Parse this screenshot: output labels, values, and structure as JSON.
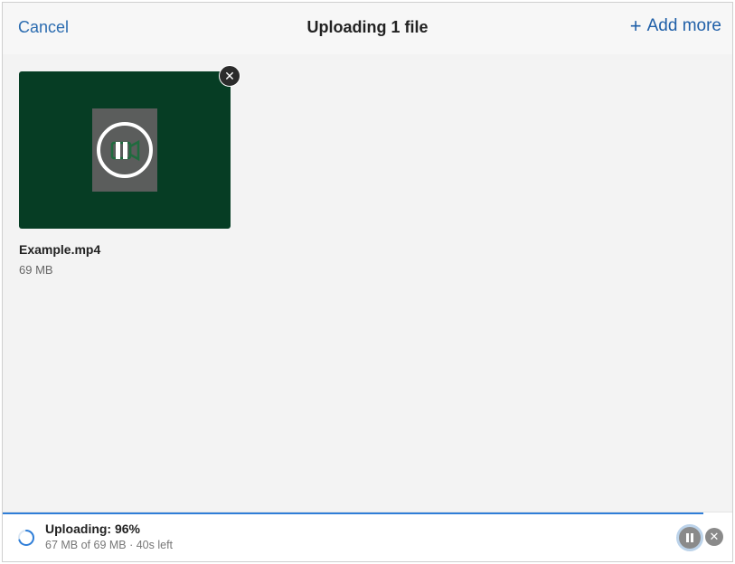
{
  "header": {
    "cancel_label": "Cancel",
    "title": "Uploading 1 file",
    "add_more_label": "Add more",
    "add_icon": "plus-icon"
  },
  "file": {
    "name": "Example.mp4",
    "size": "69 MB",
    "thumbnail_bg": "#063d24",
    "thumbnail_icon": "video-pause-icon",
    "remove_icon": "close-icon"
  },
  "status": {
    "title": "Uploading: 96%",
    "detail": "67 MB of 69 MB · 40s left",
    "progress_percent": 96,
    "progress_color": "#2f7ed8",
    "pause_icon": "pause-icon",
    "cancel_icon": "close-icon"
  },
  "colors": {
    "accent": "#2b6cb0",
    "background": "#f3f3f3"
  }
}
